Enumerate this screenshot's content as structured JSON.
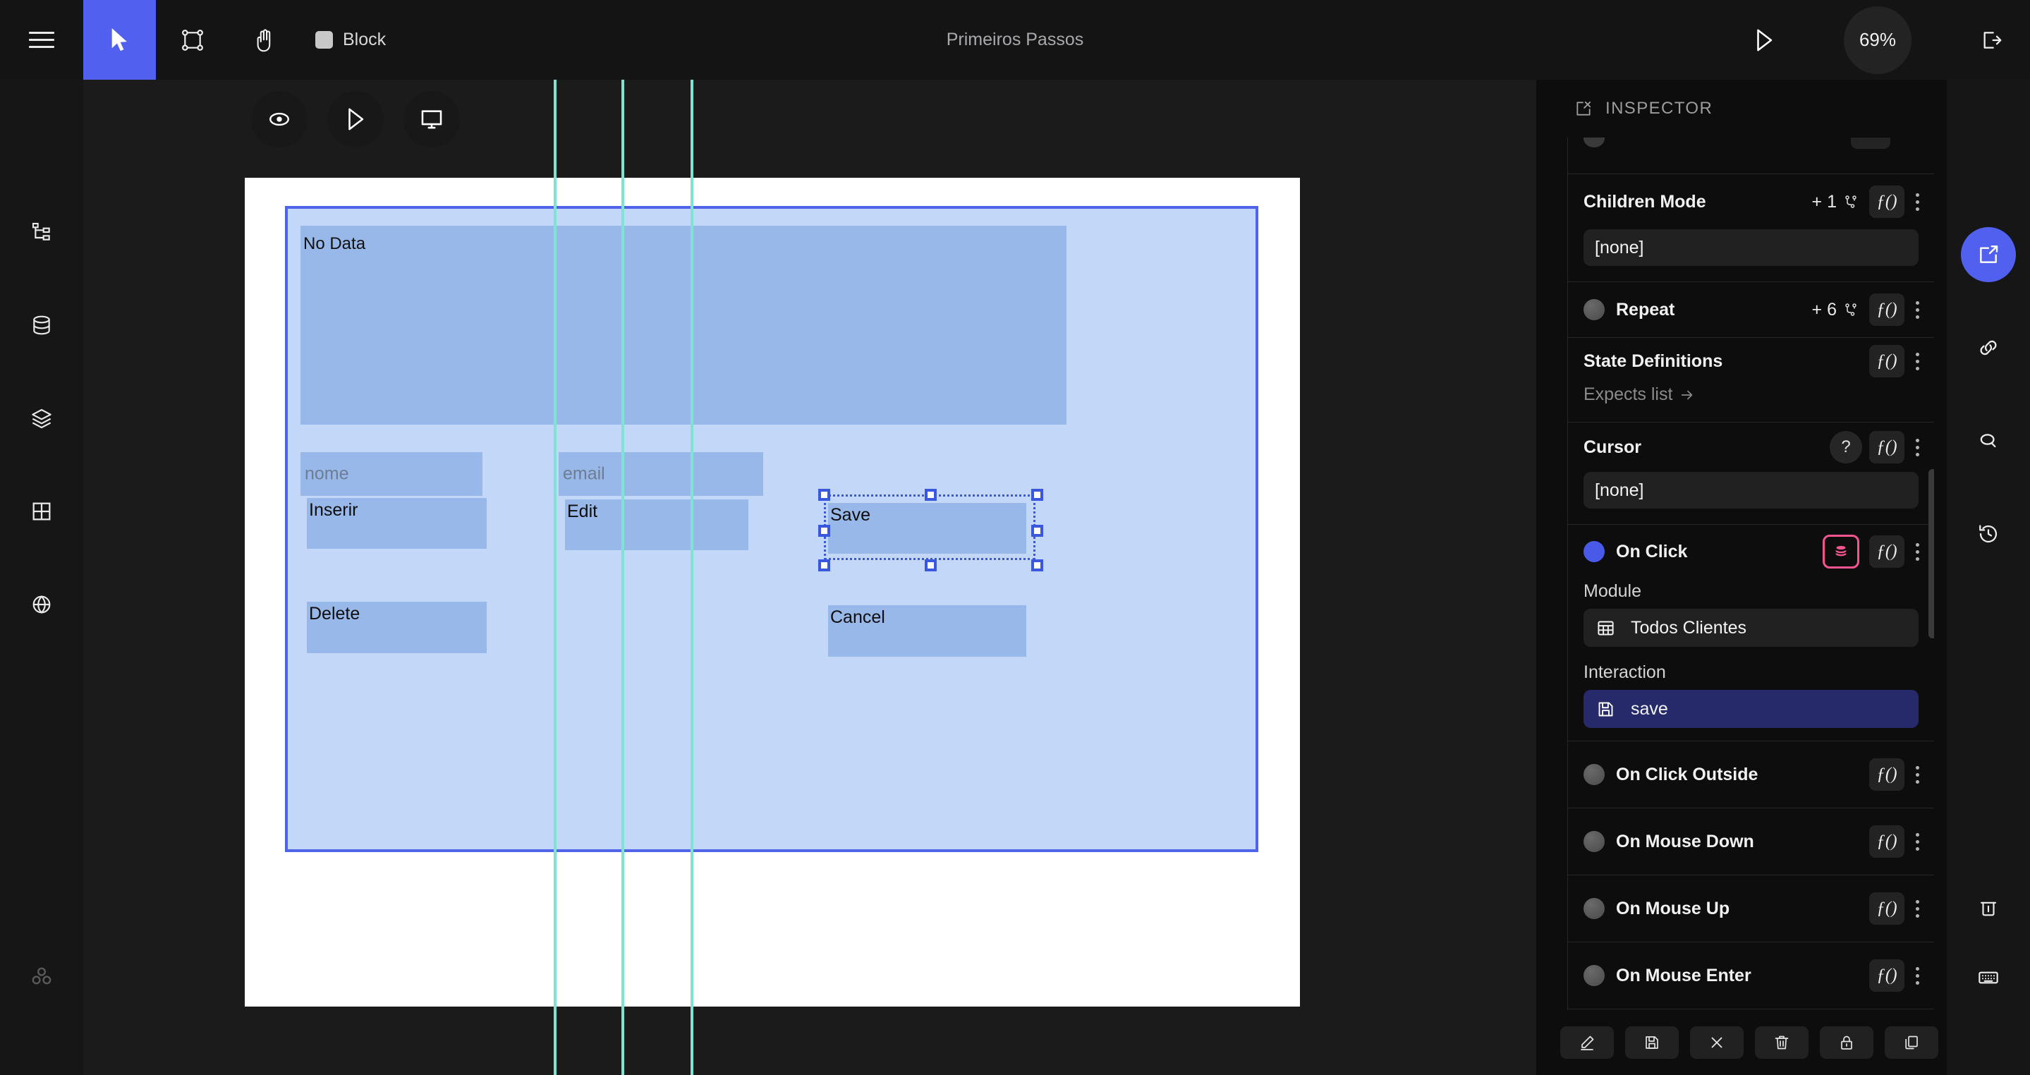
{
  "topbar": {
    "menu_icon": "hamburger-icon",
    "tools": [
      {
        "id": "select",
        "icon": "cursor-arrow-icon",
        "active": true
      },
      {
        "id": "frame",
        "icon": "frame-nodes-icon",
        "active": false
      },
      {
        "id": "pan",
        "icon": "hand-icon",
        "active": false
      }
    ],
    "block_label": "Block",
    "title": "Primeiros Passos",
    "play_icon": "play-triangle-icon",
    "zoom_level": "69%",
    "exit_icon": "exit-arrow-icon"
  },
  "left_rail": {
    "items": [
      {
        "id": "tree",
        "icon": "hierarchy-tree-icon"
      },
      {
        "id": "database",
        "icon": "database-icon"
      },
      {
        "id": "layers",
        "icon": "layers-icon"
      },
      {
        "id": "grid",
        "icon": "grid-table-icon"
      },
      {
        "id": "globe",
        "icon": "globe-icon"
      },
      {
        "id": "team",
        "icon": "three-circles-icon"
      }
    ]
  },
  "canvas": {
    "float_tools": [
      {
        "id": "preview",
        "icon": "eye-icon"
      },
      {
        "id": "run",
        "icon": "play-triangle-icon"
      },
      {
        "id": "device",
        "icon": "monitor-icon"
      }
    ],
    "artboard": {
      "no_data_label": "No Data",
      "fields": [
        {
          "id": "nome",
          "placeholder": "nome"
        },
        {
          "id": "email",
          "placeholder": "email"
        }
      ],
      "buttons": [
        {
          "id": "inserir",
          "label": "Inserir"
        },
        {
          "id": "edit",
          "label": "Edit"
        },
        {
          "id": "save",
          "label": "Save",
          "selected": true
        },
        {
          "id": "delete",
          "label": "Delete"
        },
        {
          "id": "cancel",
          "label": "Cancel"
        }
      ]
    }
  },
  "inspector": {
    "header_title": "INSPECTOR",
    "header_icon": "edit-square-icon",
    "properties": [
      {
        "id": "children-mode",
        "name": "Children Mode",
        "badge": "+ 1",
        "badge_icon": "branch-icon",
        "fx": "ƒ()",
        "value": "[none]",
        "has_dot": false
      },
      {
        "id": "repeat",
        "name": "Repeat",
        "badge": "+ 6",
        "badge_icon": "branch-icon",
        "fx": "ƒ()",
        "has_dot": true,
        "dot_on": false
      },
      {
        "id": "state-definitions",
        "name": "State Definitions",
        "fx": "ƒ()",
        "note": "Expects list",
        "note_icon": "arrow-right-icon",
        "has_dot": false
      },
      {
        "id": "cursor",
        "name": "Cursor",
        "help": "?",
        "fx": "ƒ()",
        "value": "[none]",
        "has_dot": false
      },
      {
        "id": "on-click",
        "name": "On Click",
        "fx": "ƒ()",
        "db_icon": "database-icon",
        "has_dot": true,
        "dot_on": true,
        "module_label": "Module",
        "module_value": "Todos Clientes",
        "module_icon": "grid-table-icon",
        "interaction_label": "Interaction",
        "interaction_value": "save",
        "interaction_icon": "floppy-save-icon"
      },
      {
        "id": "on-click-outside",
        "name": "On Click Outside",
        "fx": "ƒ()",
        "has_dot": true,
        "dot_on": false
      },
      {
        "id": "on-mouse-down",
        "name": "On Mouse Down",
        "fx": "ƒ()",
        "has_dot": true,
        "dot_on": false
      },
      {
        "id": "on-mouse-up",
        "name": "On Mouse Up",
        "fx": "ƒ()",
        "has_dot": true,
        "dot_on": false
      },
      {
        "id": "on-mouse-enter",
        "name": "On Mouse Enter",
        "fx": "ƒ()",
        "has_dot": true,
        "dot_on": false
      }
    ],
    "footer_buttons": [
      {
        "id": "edit",
        "icon": "pencil-icon"
      },
      {
        "id": "save",
        "icon": "floppy-save-icon"
      },
      {
        "id": "close",
        "icon": "close-x-icon"
      },
      {
        "id": "delete",
        "icon": "trash-icon"
      },
      {
        "id": "lock",
        "icon": "lock-icon"
      },
      {
        "id": "duplicate",
        "icon": "copy-icon"
      }
    ]
  },
  "right_rail": {
    "items": [
      {
        "id": "editor",
        "icon": "edit-square-icon",
        "active": true
      },
      {
        "id": "link",
        "icon": "link-chain-icon",
        "active": false
      },
      {
        "id": "search",
        "icon": "search-icon",
        "active": false
      },
      {
        "id": "history",
        "icon": "history-clock-icon",
        "active": false
      },
      {
        "id": "trash",
        "icon": "trash-icon",
        "active": false
      },
      {
        "id": "keyboard",
        "icon": "keyboard-icon",
        "active": false
      }
    ]
  },
  "colors": {
    "accent": "#5160ef",
    "panel_bg": "#0d0d0d",
    "canvas_bg": "#1b1b1b",
    "block_fill": "#c3d8f8",
    "element_fill": "#97b8e8",
    "guide": "#7fe3d4",
    "selection": "#3a57e0",
    "pink": "#f2558f",
    "save_chip": "#262a6b"
  }
}
